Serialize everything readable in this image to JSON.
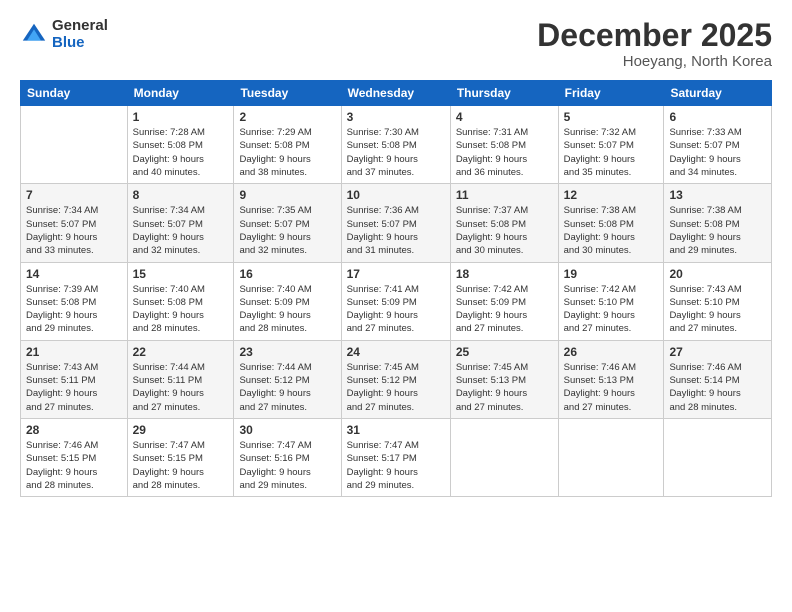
{
  "header": {
    "logo_general": "General",
    "logo_blue": "Blue",
    "month_title": "December 2025",
    "location": "Hoeyang, North Korea"
  },
  "calendar": {
    "headers": [
      "Sunday",
      "Monday",
      "Tuesday",
      "Wednesday",
      "Thursday",
      "Friday",
      "Saturday"
    ],
    "weeks": [
      [
        {
          "num": "",
          "info": ""
        },
        {
          "num": "1",
          "info": "Sunrise: 7:28 AM\nSunset: 5:08 PM\nDaylight: 9 hours\nand 40 minutes."
        },
        {
          "num": "2",
          "info": "Sunrise: 7:29 AM\nSunset: 5:08 PM\nDaylight: 9 hours\nand 38 minutes."
        },
        {
          "num": "3",
          "info": "Sunrise: 7:30 AM\nSunset: 5:08 PM\nDaylight: 9 hours\nand 37 minutes."
        },
        {
          "num": "4",
          "info": "Sunrise: 7:31 AM\nSunset: 5:08 PM\nDaylight: 9 hours\nand 36 minutes."
        },
        {
          "num": "5",
          "info": "Sunrise: 7:32 AM\nSunset: 5:07 PM\nDaylight: 9 hours\nand 35 minutes."
        },
        {
          "num": "6",
          "info": "Sunrise: 7:33 AM\nSunset: 5:07 PM\nDaylight: 9 hours\nand 34 minutes."
        }
      ],
      [
        {
          "num": "7",
          "info": "Sunrise: 7:34 AM\nSunset: 5:07 PM\nDaylight: 9 hours\nand 33 minutes."
        },
        {
          "num": "8",
          "info": "Sunrise: 7:34 AM\nSunset: 5:07 PM\nDaylight: 9 hours\nand 32 minutes."
        },
        {
          "num": "9",
          "info": "Sunrise: 7:35 AM\nSunset: 5:07 PM\nDaylight: 9 hours\nand 32 minutes."
        },
        {
          "num": "10",
          "info": "Sunrise: 7:36 AM\nSunset: 5:07 PM\nDaylight: 9 hours\nand 31 minutes."
        },
        {
          "num": "11",
          "info": "Sunrise: 7:37 AM\nSunset: 5:08 PM\nDaylight: 9 hours\nand 30 minutes."
        },
        {
          "num": "12",
          "info": "Sunrise: 7:38 AM\nSunset: 5:08 PM\nDaylight: 9 hours\nand 30 minutes."
        },
        {
          "num": "13",
          "info": "Sunrise: 7:38 AM\nSunset: 5:08 PM\nDaylight: 9 hours\nand 29 minutes."
        }
      ],
      [
        {
          "num": "14",
          "info": "Sunrise: 7:39 AM\nSunset: 5:08 PM\nDaylight: 9 hours\nand 29 minutes."
        },
        {
          "num": "15",
          "info": "Sunrise: 7:40 AM\nSunset: 5:08 PM\nDaylight: 9 hours\nand 28 minutes."
        },
        {
          "num": "16",
          "info": "Sunrise: 7:40 AM\nSunset: 5:09 PM\nDaylight: 9 hours\nand 28 minutes."
        },
        {
          "num": "17",
          "info": "Sunrise: 7:41 AM\nSunset: 5:09 PM\nDaylight: 9 hours\nand 27 minutes."
        },
        {
          "num": "18",
          "info": "Sunrise: 7:42 AM\nSunset: 5:09 PM\nDaylight: 9 hours\nand 27 minutes."
        },
        {
          "num": "19",
          "info": "Sunrise: 7:42 AM\nSunset: 5:10 PM\nDaylight: 9 hours\nand 27 minutes."
        },
        {
          "num": "20",
          "info": "Sunrise: 7:43 AM\nSunset: 5:10 PM\nDaylight: 9 hours\nand 27 minutes."
        }
      ],
      [
        {
          "num": "21",
          "info": "Sunrise: 7:43 AM\nSunset: 5:11 PM\nDaylight: 9 hours\nand 27 minutes."
        },
        {
          "num": "22",
          "info": "Sunrise: 7:44 AM\nSunset: 5:11 PM\nDaylight: 9 hours\nand 27 minutes."
        },
        {
          "num": "23",
          "info": "Sunrise: 7:44 AM\nSunset: 5:12 PM\nDaylight: 9 hours\nand 27 minutes."
        },
        {
          "num": "24",
          "info": "Sunrise: 7:45 AM\nSunset: 5:12 PM\nDaylight: 9 hours\nand 27 minutes."
        },
        {
          "num": "25",
          "info": "Sunrise: 7:45 AM\nSunset: 5:13 PM\nDaylight: 9 hours\nand 27 minutes."
        },
        {
          "num": "26",
          "info": "Sunrise: 7:46 AM\nSunset: 5:13 PM\nDaylight: 9 hours\nand 27 minutes."
        },
        {
          "num": "27",
          "info": "Sunrise: 7:46 AM\nSunset: 5:14 PM\nDaylight: 9 hours\nand 28 minutes."
        }
      ],
      [
        {
          "num": "28",
          "info": "Sunrise: 7:46 AM\nSunset: 5:15 PM\nDaylight: 9 hours\nand 28 minutes."
        },
        {
          "num": "29",
          "info": "Sunrise: 7:47 AM\nSunset: 5:15 PM\nDaylight: 9 hours\nand 28 minutes."
        },
        {
          "num": "30",
          "info": "Sunrise: 7:47 AM\nSunset: 5:16 PM\nDaylight: 9 hours\nand 29 minutes."
        },
        {
          "num": "31",
          "info": "Sunrise: 7:47 AM\nSunset: 5:17 PM\nDaylight: 9 hours\nand 29 minutes."
        },
        {
          "num": "",
          "info": ""
        },
        {
          "num": "",
          "info": ""
        },
        {
          "num": "",
          "info": ""
        }
      ]
    ]
  }
}
